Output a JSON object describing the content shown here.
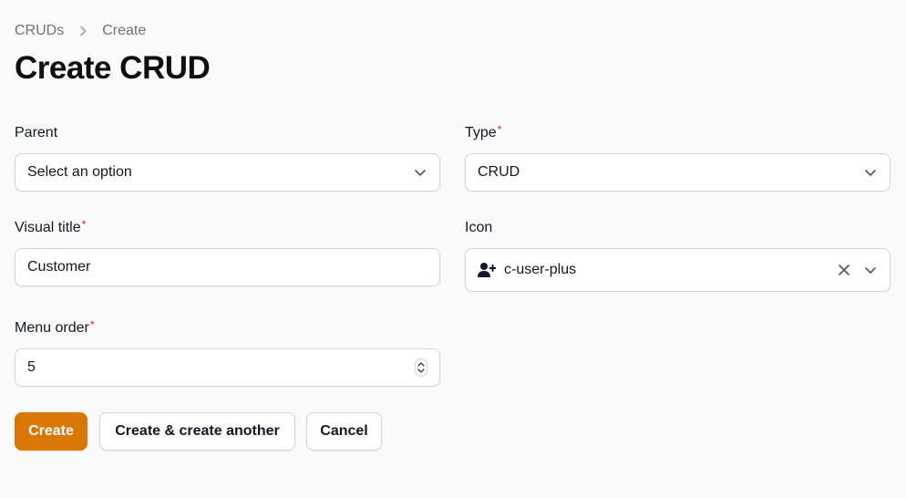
{
  "breadcrumb": {
    "root": "CRUDs",
    "current": "Create"
  },
  "page": {
    "title": "Create CRUD"
  },
  "form": {
    "parent": {
      "label": "Parent",
      "value": "Select an option"
    },
    "type": {
      "label": "Type",
      "required": "*",
      "value": "CRUD"
    },
    "visual_title": {
      "label": "Visual title",
      "required": "*",
      "value": "Customer"
    },
    "icon": {
      "label": "Icon",
      "value": "c-user-plus",
      "icon_name": "user-plus-icon"
    },
    "menu_order": {
      "label": "Menu order",
      "required": "*",
      "value": "5"
    }
  },
  "actions": {
    "create": "Create",
    "create_another": "Create & create another",
    "cancel": "Cancel"
  },
  "colors": {
    "primary": "#d97706",
    "required": "#dc2626",
    "background": "#fafafa"
  }
}
